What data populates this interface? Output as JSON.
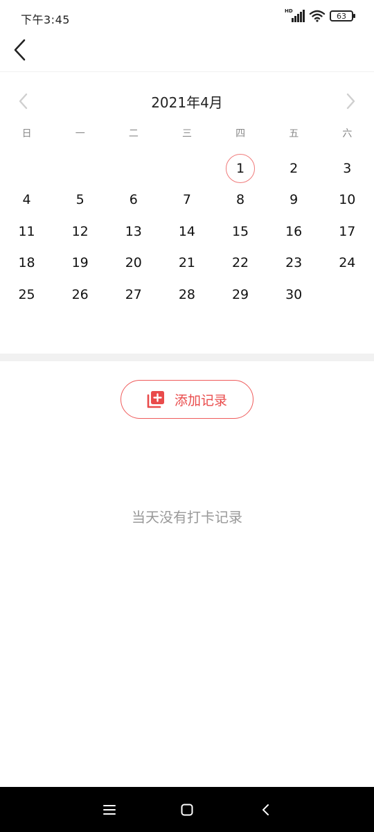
{
  "status_bar": {
    "time": "下午3:45",
    "hd_label": "HD",
    "battery_level": "63"
  },
  "icons": {
    "back": "back-arrow-icon",
    "prev_month": "chevron-left-icon",
    "next_month": "chevron-right-icon",
    "add_record": "add-square-icon",
    "nav_menu": "menu-icon",
    "nav_home": "home-square-icon",
    "nav_back": "nav-back-icon"
  },
  "calendar": {
    "month_title": "2021年4月",
    "weekdays": [
      "日",
      "一",
      "二",
      "三",
      "四",
      "五",
      "六"
    ],
    "days": [
      "",
      "",
      "",
      "",
      "1",
      "2",
      "3",
      "4",
      "5",
      "6",
      "7",
      "8",
      "9",
      "10",
      "11",
      "12",
      "13",
      "14",
      "15",
      "16",
      "17",
      "18",
      "19",
      "20",
      "21",
      "22",
      "23",
      "24",
      "25",
      "26",
      "27",
      "28",
      "29",
      "30",
      ""
    ],
    "today": "1"
  },
  "actions": {
    "add_record_label": "添加记录"
  },
  "content": {
    "empty_message": "当天没有打卡记录"
  },
  "colors": {
    "accent": "#e94b4b",
    "today_ring": "#f07a7a"
  }
}
